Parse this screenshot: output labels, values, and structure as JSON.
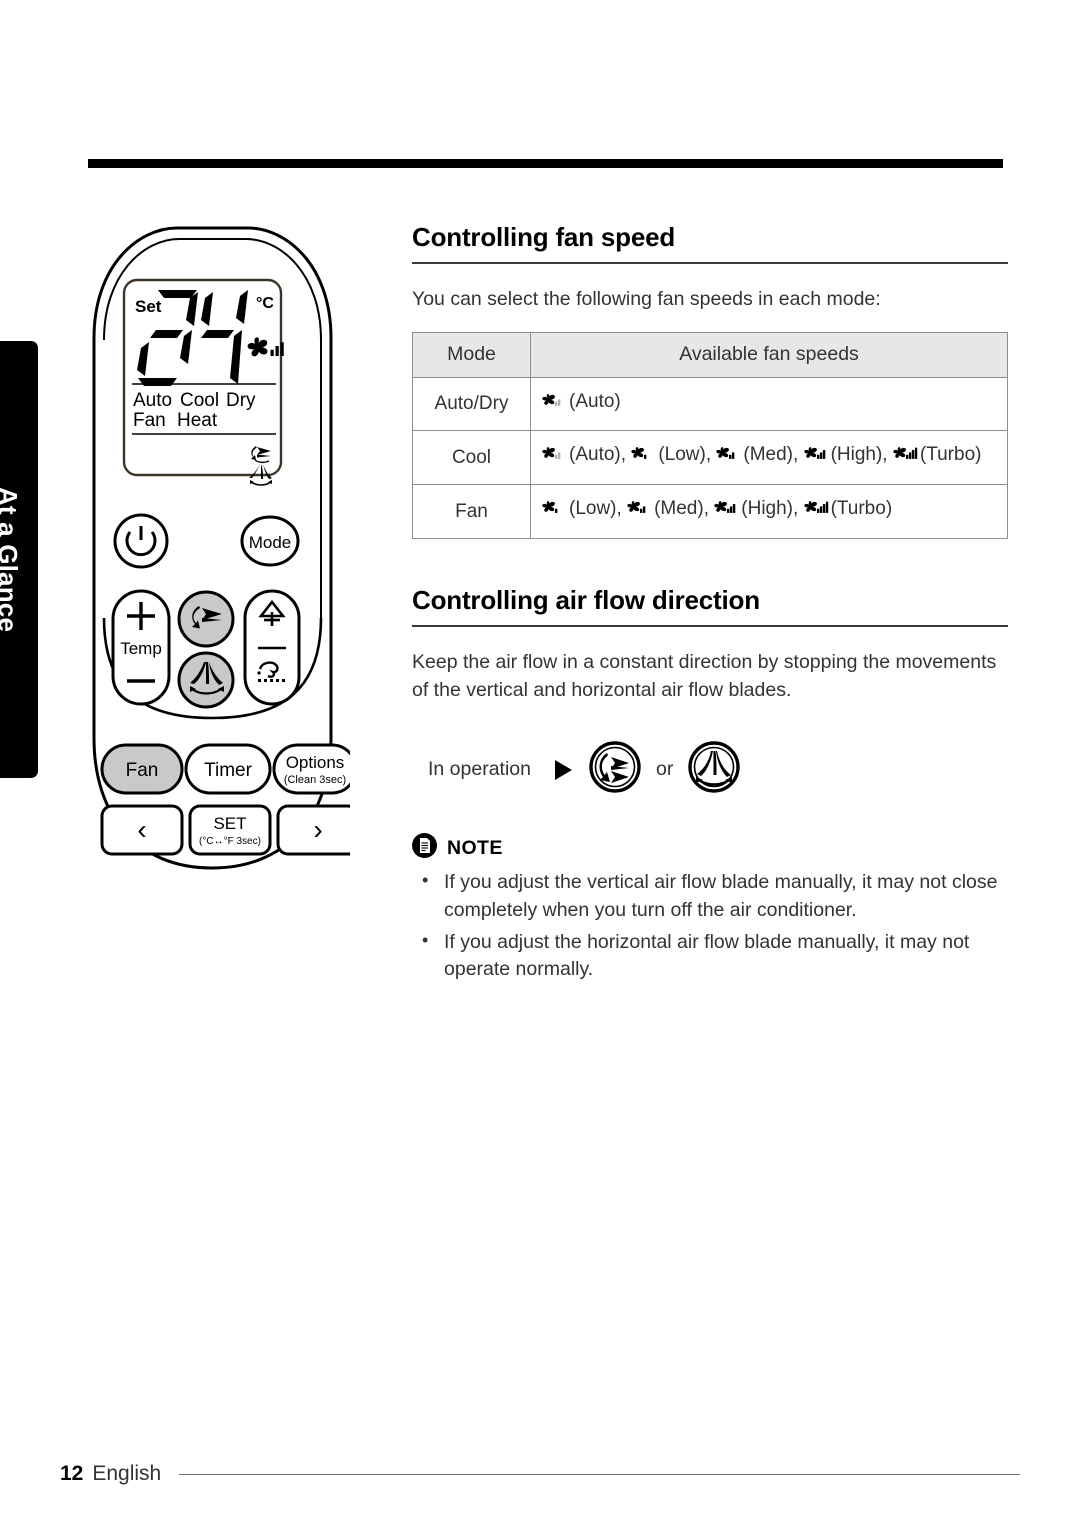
{
  "document": {
    "section_tab": "At a Glance",
    "footer": {
      "page_number": "12",
      "language": "English"
    }
  },
  "remote": {
    "lcd": {
      "set_label": "Set",
      "temperature": "24",
      "unit": "°C",
      "fan_icon": "fan-speed-icon",
      "modes_row1": [
        "Auto",
        "Cool",
        "Dry"
      ],
      "modes_row2": [
        "Fan",
        "Heat"
      ],
      "vertical_swing_icon": "vertical-swing-icon",
      "horizontal_swing_icon": "horizontal-swing-icon"
    },
    "buttons": {
      "power": "power-icon",
      "mode": "Mode",
      "temp_up": "+",
      "temp_label": "Temp",
      "temp_down": "−",
      "vertical_swing": "vertical-swing-icon",
      "horizontal_swing": "horizontal-swing-icon",
      "quiet": "quiet-icon",
      "clean": "clean-icon",
      "fan": "Fan",
      "timer": "Timer",
      "options": "Options",
      "options_sub": "(Clean 3sec)",
      "prev": "‹",
      "set": "SET",
      "set_sub": "(°C↔°F 3sec)",
      "next": "›"
    }
  },
  "sections": [
    {
      "id": "fan-speed",
      "heading": "Controlling fan speed",
      "intro": "You can select the following fan speeds in each mode:"
    },
    {
      "id": "air-flow",
      "heading": "Controlling air flow direction",
      "intro": "Keep the air flow in a constant direction by stopping the movements of the vertical and horizontal air flow blades."
    }
  ],
  "fan_table": {
    "headers": [
      "Mode",
      "Available fan speeds"
    ],
    "rows": [
      {
        "mode": "Auto/Dry",
        "speeds": [
          {
            "bars": 2,
            "muted": true,
            "label": "(Auto)"
          }
        ]
      },
      {
        "mode": "Cool",
        "speeds": [
          {
            "bars": 2,
            "muted": true,
            "label": "(Auto),"
          },
          {
            "bars": 1,
            "muted": false,
            "label": "(Low),"
          },
          {
            "bars": 2,
            "muted": false,
            "label": "(Med),"
          },
          {
            "bars": 3,
            "muted": false,
            "label": "(High),"
          },
          {
            "bars": 4,
            "muted": false,
            "label": "(Turbo)"
          }
        ]
      },
      {
        "mode": "Fan",
        "speeds": [
          {
            "bars": 1,
            "muted": false,
            "label": "(Low),"
          },
          {
            "bars": 2,
            "muted": false,
            "label": "(Med),"
          },
          {
            "bars": 3,
            "muted": false,
            "label": "(High),"
          },
          {
            "bars": 4,
            "muted": false,
            "label": "(Turbo)"
          }
        ]
      }
    ]
  },
  "in_operation": {
    "label": "In operation",
    "arrow": "▶",
    "or": "or",
    "icon_1": "vertical-swing-icon",
    "icon_2": "horizontal-swing-icon"
  },
  "note": {
    "title": "NOTE",
    "icon": "note-document-icon",
    "items": [
      "If you adjust the vertical air flow blade manually, it may not close completely when you turn off the air conditioner.",
      "If you adjust the horizontal air flow blade manually, it may not operate normally."
    ]
  },
  "colors": {
    "rule": "#000000",
    "table_header_bg": "#e6e7e8",
    "table_border": "#8e8e8e",
    "text": "#333333",
    "button_active": "#c9c9c9"
  }
}
